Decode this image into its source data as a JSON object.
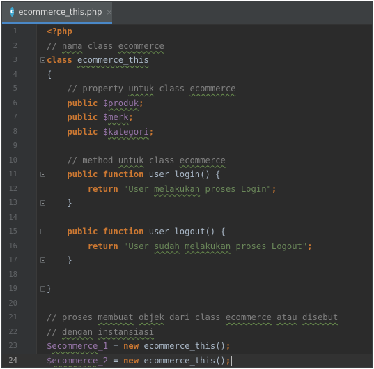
{
  "tab": {
    "icon": "c",
    "title": "ecommerce_this.php",
    "close": "×"
  },
  "colors": {
    "keyword": "#cc7832",
    "variable": "#9876aa",
    "string": "#6a8759",
    "comment": "#808080",
    "text": "#a9b7c6",
    "background": "#2b2b2b",
    "gutter": "#313335"
  },
  "editor": {
    "current_line": 24,
    "lines": [
      {
        "no": "1",
        "tokens": [
          {
            "t": "<?php",
            "c": "tag"
          }
        ]
      },
      {
        "no": "2",
        "tokens": [
          {
            "t": "// ",
            "c": "com"
          },
          {
            "t": "nama",
            "c": "com sq"
          },
          {
            "t": " class ",
            "c": "com"
          },
          {
            "t": "ecommerce",
            "c": "com sq"
          }
        ]
      },
      {
        "no": "3",
        "tokens": [
          {
            "t": "class ",
            "c": "kw"
          },
          {
            "t": "ecommerce_this",
            "c": "pl sq"
          }
        ]
      },
      {
        "no": "4",
        "tokens": [
          {
            "t": "{",
            "c": "pl"
          }
        ]
      },
      {
        "no": "5",
        "tokens": [
          {
            "t": "    // property ",
            "c": "com"
          },
          {
            "t": "untuk",
            "c": "com sq"
          },
          {
            "t": " class ",
            "c": "com"
          },
          {
            "t": "ecommerce",
            "c": "com sq"
          }
        ]
      },
      {
        "no": "6",
        "tokens": [
          {
            "t": "    public ",
            "c": "kw"
          },
          {
            "t": "$",
            "c": "var"
          },
          {
            "t": "produk",
            "c": "var sq"
          },
          {
            "t": ";",
            "c": "kw"
          }
        ]
      },
      {
        "no": "7",
        "tokens": [
          {
            "t": "    public ",
            "c": "kw"
          },
          {
            "t": "$",
            "c": "var"
          },
          {
            "t": "merk",
            "c": "var sq"
          },
          {
            "t": ";",
            "c": "kw"
          }
        ]
      },
      {
        "no": "8",
        "tokens": [
          {
            "t": "    public ",
            "c": "kw"
          },
          {
            "t": "$",
            "c": "var"
          },
          {
            "t": "kategori",
            "c": "var sq"
          },
          {
            "t": ";",
            "c": "kw"
          }
        ]
      },
      {
        "no": "9",
        "tokens": []
      },
      {
        "no": "10",
        "tokens": [
          {
            "t": "    // method ",
            "c": "com"
          },
          {
            "t": "untuk",
            "c": "com sq"
          },
          {
            "t": " class ",
            "c": "com"
          },
          {
            "t": "ecommerce",
            "c": "com sq"
          }
        ]
      },
      {
        "no": "11",
        "tokens": [
          {
            "t": "    public function ",
            "c": "kw"
          },
          {
            "t": "user_login",
            "c": "fn"
          },
          {
            "t": "() {",
            "c": "pl"
          }
        ]
      },
      {
        "no": "12",
        "tokens": [
          {
            "t": "        return ",
            "c": "kw"
          },
          {
            "t": "\"User ",
            "c": "str"
          },
          {
            "t": "melakukan",
            "c": "str sq"
          },
          {
            "t": " proses Login\"",
            "c": "str"
          },
          {
            "t": ";",
            "c": "kw"
          }
        ]
      },
      {
        "no": "13",
        "tokens": [
          {
            "t": "    }",
            "c": "pl"
          }
        ]
      },
      {
        "no": "14",
        "tokens": []
      },
      {
        "no": "15",
        "tokens": [
          {
            "t": "    public function ",
            "c": "kw"
          },
          {
            "t": "user_logout",
            "c": "fn"
          },
          {
            "t": "() {",
            "c": "pl"
          }
        ]
      },
      {
        "no": "16",
        "tokens": [
          {
            "t": "        return ",
            "c": "kw"
          },
          {
            "t": "\"User ",
            "c": "str"
          },
          {
            "t": "sudah",
            "c": "str sq"
          },
          {
            "t": " ",
            "c": "str"
          },
          {
            "t": "melakukan",
            "c": "str sq"
          },
          {
            "t": " proses Logout\"",
            "c": "str"
          },
          {
            "t": ";",
            "c": "kw"
          }
        ]
      },
      {
        "no": "17",
        "tokens": [
          {
            "t": "    }",
            "c": "pl"
          }
        ]
      },
      {
        "no": "18",
        "tokens": []
      },
      {
        "no": "19",
        "tokens": [
          {
            "t": "}",
            "c": "pl"
          }
        ]
      },
      {
        "no": "20",
        "tokens": []
      },
      {
        "no": "21",
        "tokens": [
          {
            "t": "// proses ",
            "c": "com"
          },
          {
            "t": "membuat",
            "c": "com sq"
          },
          {
            "t": " ",
            "c": "com"
          },
          {
            "t": "objek",
            "c": "com sq"
          },
          {
            "t": " dari class ",
            "c": "com"
          },
          {
            "t": "ecommerce",
            "c": "com sq"
          },
          {
            "t": " ",
            "c": "com"
          },
          {
            "t": "atau",
            "c": "com sq"
          },
          {
            "t": " ",
            "c": "com"
          },
          {
            "t": "disebut",
            "c": "com sq"
          }
        ]
      },
      {
        "no": "22",
        "tokens": [
          {
            "t": "// ",
            "c": "com"
          },
          {
            "t": "dengan",
            "c": "com sq"
          },
          {
            "t": " ",
            "c": "com"
          },
          {
            "t": "instansiasi",
            "c": "com sq"
          }
        ]
      },
      {
        "no": "23",
        "tokens": [
          {
            "t": "$",
            "c": "var"
          },
          {
            "t": "ecommerce",
            "c": "var sq"
          },
          {
            "t": "_1",
            "c": "var"
          },
          {
            "t": " = ",
            "c": "pl"
          },
          {
            "t": "new ",
            "c": "kw"
          },
          {
            "t": "ecommerce_this",
            "c": "pl"
          },
          {
            "t": "()",
            "c": "pl"
          },
          {
            "t": ";",
            "c": "kw"
          }
        ]
      },
      {
        "no": "24",
        "tokens": [
          {
            "t": "$",
            "c": "var"
          },
          {
            "t": "ecommerce",
            "c": "var sq"
          },
          {
            "t": "_2",
            "c": "var"
          },
          {
            "t": " = ",
            "c": "pl"
          },
          {
            "t": "new ",
            "c": "kw"
          },
          {
            "t": "ecommerce_this",
            "c": "pl"
          },
          {
            "t": "()",
            "c": "pl"
          },
          {
            "t": ";",
            "c": "kw"
          }
        ]
      }
    ],
    "fold_markers": [
      "3",
      "11",
      "13",
      "15",
      "17",
      "19"
    ]
  }
}
